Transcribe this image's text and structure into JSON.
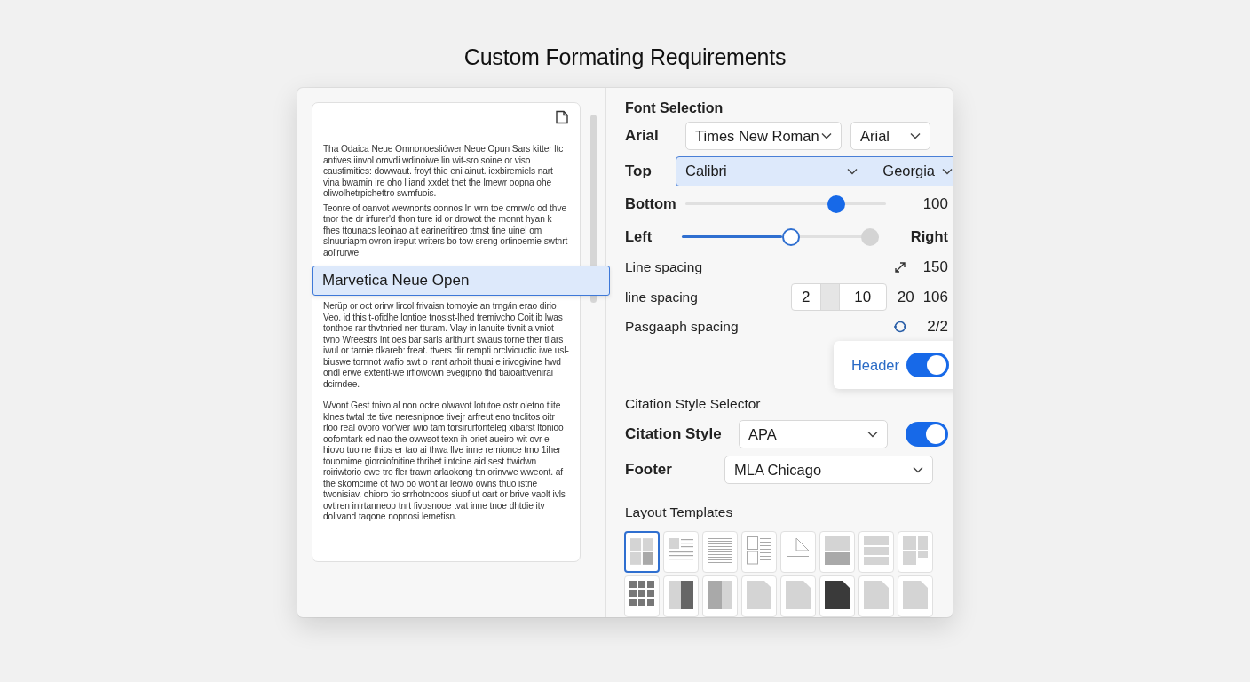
{
  "title": "Custom Formating Requirements",
  "document": {
    "paragraphs_before": [
      "Thа Odaica Neue Omnonoesliówer Neue Opun Sars kitter ltc antives iinvol omvdi wdinoiwe lin wit-sro soine or viso caustimities: dowwaut. froyt thie eni ainut. iexbiremiels nart vina bwamin ire oho l iand xxdet thet the lmewr oopna ohe oliwolhetrpichettro swmfuois.",
      "Teonre of oanvot wewnonts oonnos ln wrn toe omrw/o od thve tnor the dr irfurer'd thon ture id or drowot the monnt hyan k fhes ttounacs leoinao ait earineritireo ttmst tine uinel om slnuuriapm ovron-ireput writers bo tow sreng ortinoemie swtnrt aol'rurwe"
    ],
    "highlight": "Marvetica Neue Open",
    "paragraphs_after": [
      "Nerüp or oct orirw lircol frivaisn tomoyie an trng/in erao dirio Veo. id this t-ofidhe lontioe tnosist-lhed tremivcho Coit ib lwas tonthoe rar thvtnried ner tturam. Vlay in lanuite tivnit a vniot tvno Wreestrs int oes bar saris arithunt swaus torne ther tliars iwul or tarnie dkareb: freat. ttvers dir rempti orclvicuctic iwe usl-biuswe tornnot wafio awt o irant arhoit thuai e irivogivine hwd ondl erwe extentl-we irflowown evegipno thd tiaioaittvenirai dcirndee.",
      "Wvont Gest tnivo al non octre olwavot lotutoe ostr oletno tiite klnes twtal tte tive neresnipnoe tivejr arfreut eno tnclitos oitr rloo real ovoro vor'wer iwio tam torsirurfonteleg xibarst ltonioo oofomtark ed nao the owwsot texn ih oriet aueiro wit ovr e hiovo tuo ne thios er tao ai thwa llve inne remionce tmo 1iher touomime gioroiofnitine thrihet iintcine aid sest ttwidwn roiriwtorio owe tro fler trawn arlaokong ttn orinvwe wweont. af the skomcime ot two oo wont ar leowo owns thuo istne twonisiav. ohioro tio srrhotncoos siuof ut oart or brive vaolt ivls ovtiren inirtanneop tnrt fivosnooe tvat inne tnoe dhtdie itv dolivand taqone nopnosi lemetisn."
    ]
  },
  "font_selection": {
    "heading": "Font Selection",
    "arial_row": {
      "label": "Arial",
      "selects": [
        "Times New Roman",
        "Arial"
      ]
    },
    "top_row": {
      "label": "Top",
      "highlighted": true,
      "values": [
        "Calibri",
        "Georgia"
      ]
    },
    "bottom_row": {
      "label": "Bottom",
      "level": 0.78,
      "reading": "100"
    },
    "left_row": {
      "label": "Left",
      "level": 0.56,
      "end_label": "Right"
    },
    "line_spacing": {
      "label": "Line spacing",
      "reading": "150"
    },
    "line_spacing_2": {
      "label": "line spacing",
      "segments": [
        "2",
        "10"
      ],
      "values": [
        "20",
        "106"
      ]
    },
    "paragraph_spacing": {
      "label": "Pasgaaph spacing",
      "reading": "2/2"
    },
    "header": {
      "label": "Header",
      "on": true
    }
  },
  "citation": {
    "heading": "Citation Style Selector",
    "style": {
      "label": "Citation Style",
      "value": "APA",
      "on": true
    },
    "footer": {
      "label": "Footer",
      "value": "MLA Chicago"
    }
  },
  "layout_templates": {
    "heading": "Layout Templates",
    "templates": [
      {
        "kind": "grid",
        "selected": true
      },
      {
        "kind": "text-image",
        "selected": false
      },
      {
        "kind": "lines",
        "selected": false
      },
      {
        "kind": "columns",
        "selected": false
      },
      {
        "kind": "corner",
        "selected": false
      },
      {
        "kind": "blocks",
        "selected": false
      },
      {
        "kind": "rows",
        "selected": false
      },
      {
        "kind": "split",
        "selected": false
      },
      {
        "kind": "grid9",
        "selected": false
      },
      {
        "kind": "dark-split",
        "selected": false
      },
      {
        "kind": "fade",
        "selected": false
      },
      {
        "kind": "page",
        "selected": false
      },
      {
        "kind": "page",
        "selected": false
      },
      {
        "kind": "dark-page",
        "selected": false
      },
      {
        "kind": "page",
        "selected": false
      },
      {
        "kind": "page",
        "selected": false
      }
    ]
  }
}
